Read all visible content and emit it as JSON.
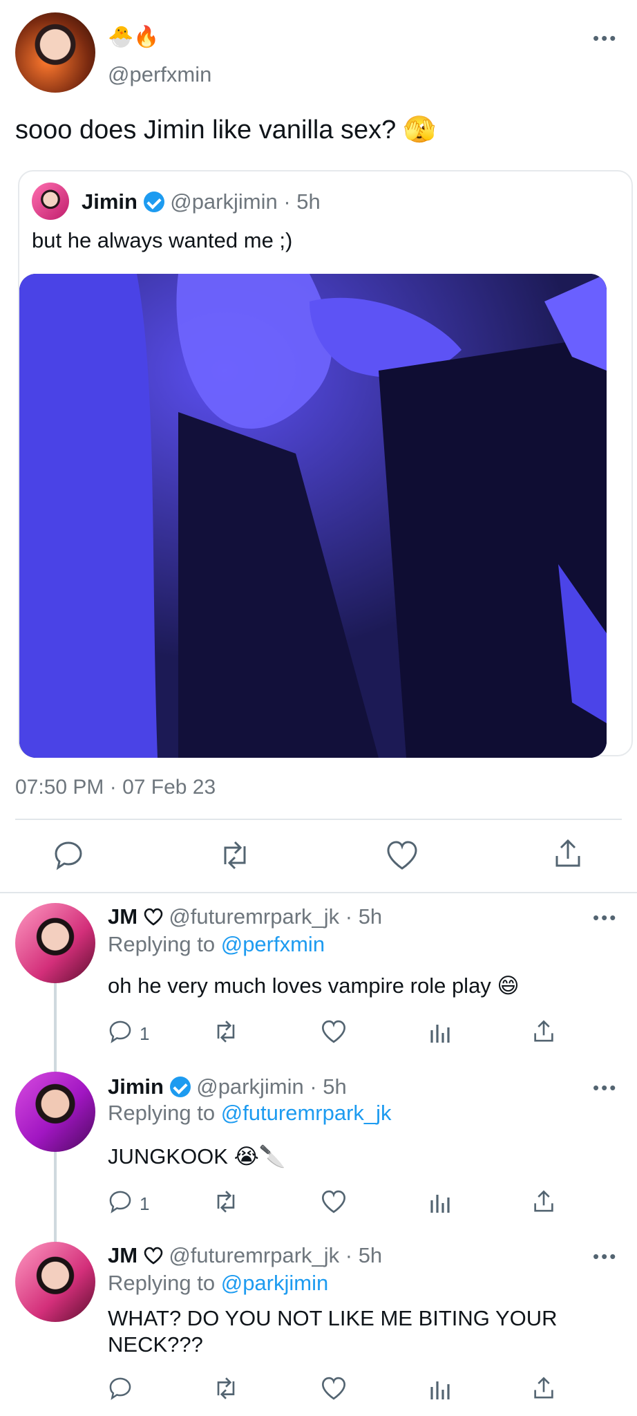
{
  "main_tweet": {
    "display_name_emojis": "🐣🔥",
    "handle": "@perfxmin",
    "text": "sooo does Jimin like vanilla sex? 🫣",
    "timestamp": "07:50 PM · 07 Feb 23",
    "more": "•••",
    "quoted": {
      "name": "Jimin",
      "handle_time": "@parkjimin · 5h",
      "text": "but he always wanted me ;)"
    }
  },
  "replies": [
    {
      "name": "JM",
      "handle_time": "@futuremrpark_jk · 5h",
      "replying_prefix": "Replying to",
      "replying_to": "@perfxmin",
      "text": "oh he very much loves vampire role play 😄",
      "reply_count": "1"
    },
    {
      "name": "Jimin",
      "handle_time": "@parkjimin · 5h",
      "replying_prefix": "Replying to",
      "replying_to": "@futuremrpark_jk",
      "text": "JUNGKOOK 😭🔪",
      "reply_count": "1"
    },
    {
      "name": "JM",
      "handle_time": "@futuremrpark_jk · 5h",
      "replying_prefix": "Replying to",
      "replying_to": "@parkjimin",
      "text": "WHAT? DO YOU NOT LIKE ME BITING YOUR NECK???",
      "reply_count": ""
    }
  ],
  "icons": {
    "reply": "reply-icon",
    "retweet": "retweet-icon",
    "like": "heart-icon",
    "views": "views-icon",
    "share": "share-icon"
  },
  "colors": {
    "accent": "#1d9bf0",
    "text": "#0f1419",
    "secondary": "#6e767d"
  }
}
